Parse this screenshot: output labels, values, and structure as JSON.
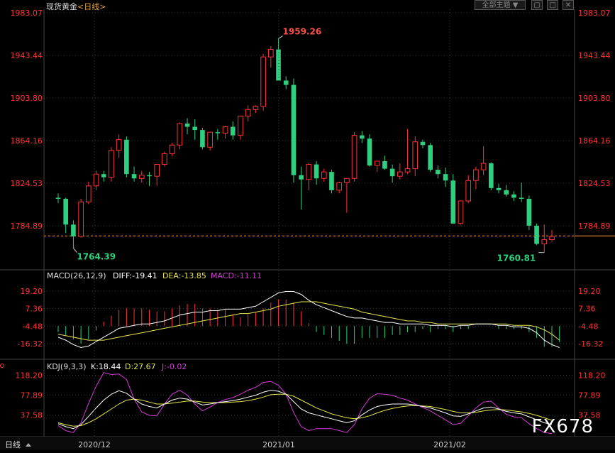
{
  "header": {
    "title": "现货黄金",
    "period": "<日线>",
    "theme_button": "全部主题",
    "theme_arrow": "▼"
  },
  "watermark": "FX678",
  "bottom_tab": "日线",
  "colors": {
    "up": "#ff3333",
    "down": "#2ecf7e",
    "axis": "#ff3333",
    "grid": "#3a3a3a",
    "white_line": "#ffffff",
    "yellow_line": "#e6e64c",
    "magenta_line": "#d43cd4",
    "current_price_line": "#ff9933"
  },
  "chart_data": [
    {
      "type": "candlestick",
      "title": "现货黄金<日线>",
      "y_ticks": [
        "1983.07",
        "1943.44",
        "1903.80",
        "1864.16",
        "1824.53",
        "1784.89"
      ],
      "ylim": [
        1745.25,
        1983.07
      ],
      "x_ticks": [
        "2020/12",
        "2021/01",
        "2021/02"
      ],
      "annotations": {
        "high": "1959.26",
        "low_left": "1764.39",
        "low_right": "1760.81"
      },
      "current_price": 1775.5,
      "candles": [
        [
          1811,
          1815,
          1806,
          1810
        ],
        [
          1810,
          1811,
          1778,
          1786
        ],
        [
          1786,
          1790,
          1764,
          1775
        ],
        [
          1775,
          1810,
          1774,
          1807
        ],
        [
          1807,
          1826,
          1805,
          1822
        ],
        [
          1822,
          1836,
          1818,
          1833
        ],
        [
          1833,
          1836,
          1826,
          1830
        ],
        [
          1830,
          1858,
          1826,
          1855
        ],
        [
          1855,
          1870,
          1848,
          1865
        ],
        [
          1865,
          1868,
          1830,
          1833
        ],
        [
          1833,
          1840,
          1826,
          1829
        ],
        [
          1829,
          1836,
          1825,
          1832
        ],
        [
          1832,
          1835,
          1822,
          1831
        ],
        [
          1831,
          1841,
          1822,
          1842
        ],
        [
          1842,
          1854,
          1840,
          1852
        ],
        [
          1852,
          1862,
          1850,
          1860
        ],
        [
          1860,
          1881,
          1856,
          1880
        ],
        [
          1880,
          1885,
          1870,
          1877
        ],
        [
          1877,
          1884,
          1865,
          1874
        ],
        [
          1874,
          1876,
          1856,
          1858
        ],
        [
          1858,
          1870,
          1855,
          1872
        ],
        [
          1872,
          1875,
          1865,
          1871
        ],
        [
          1871,
          1878,
          1866,
          1877
        ],
        [
          1877,
          1882,
          1865,
          1869
        ],
        [
          1869,
          1885,
          1865,
          1887
        ],
        [
          1887,
          1897,
          1882,
          1893
        ],
        [
          1893,
          1897,
          1890,
          1896
        ],
        [
          1896,
          1945,
          1892,
          1942
        ],
        [
          1942,
          1952,
          1932,
          1949
        ],
        [
          1949,
          1959,
          1945,
          1920
        ],
        [
          1920,
          1924,
          1912,
          1916
        ],
        [
          1916,
          1922,
          1825,
          1832
        ],
        [
          1832,
          1840,
          1800,
          1828
        ],
        [
          1828,
          1843,
          1818,
          1842
        ],
        [
          1842,
          1845,
          1823,
          1829
        ],
        [
          1829,
          1838,
          1826,
          1835
        ],
        [
          1835,
          1837,
          1815,
          1818
        ],
        [
          1818,
          1826,
          1815,
          1825
        ],
        [
          1825,
          1829,
          1797,
          1829
        ],
        [
          1829,
          1872,
          1826,
          1869
        ],
        [
          1869,
          1873,
          1862,
          1866
        ],
        [
          1866,
          1870,
          1840,
          1841
        ],
        [
          1841,
          1845,
          1835,
          1845
        ],
        [
          1845,
          1850,
          1837,
          1838
        ],
        [
          1838,
          1842,
          1825,
          1831
        ],
        [
          1831,
          1843,
          1828,
          1835
        ],
        [
          1835,
          1875,
          1833,
          1838
        ],
        [
          1838,
          1868,
          1831,
          1863
        ],
        [
          1863,
          1865,
          1857,
          1860
        ],
        [
          1860,
          1862,
          1835,
          1837
        ],
        [
          1837,
          1841,
          1829,
          1833
        ],
        [
          1833,
          1839,
          1821,
          1827
        ],
        [
          1827,
          1833,
          1789,
          1787
        ],
        [
          1787,
          1808,
          1786,
          1808
        ],
        [
          1808,
          1832,
          1806,
          1827
        ],
        [
          1827,
          1840,
          1819,
          1837
        ],
        [
          1837,
          1859,
          1832,
          1843
        ],
        [
          1843,
          1844,
          1818,
          1820
        ],
        [
          1820,
          1824,
          1815,
          1818
        ],
        [
          1818,
          1823,
          1812,
          1814
        ],
        [
          1814,
          1817,
          1808,
          1811
        ],
        [
          1811,
          1825,
          1807,
          1810
        ],
        [
          1810,
          1813,
          1781,
          1785
        ],
        [
          1785,
          1787,
          1767,
          1768
        ],
        [
          1768,
          1786,
          1760,
          1772
        ],
        [
          1772,
          1781,
          1770,
          1775
        ]
      ]
    },
    {
      "type": "macd",
      "label": "MACD(26,12,9)",
      "legend": {
        "diff": "DIFF:-19.41",
        "dea": "DEA:-13.85",
        "macd": "MACD:-11.11"
      },
      "y_ticks": [
        "19.20",
        "7.36",
        "-4.48",
        "-16.32"
      ],
      "ylim": [
        -26,
        25
      ],
      "diff": [
        -12,
        -14,
        -17,
        -19,
        -18,
        -15,
        -12,
        -9,
        -6,
        -5,
        -4,
        -3,
        -3,
        -2,
        -1,
        1,
        3,
        4,
        5,
        5,
        6,
        6,
        7,
        7,
        7,
        8,
        9,
        12,
        15,
        18,
        19,
        19,
        17,
        13,
        10,
        8,
        6,
        4,
        2,
        1,
        1,
        0,
        -1,
        -2,
        -2,
        -3,
        -3,
        -3,
        -3,
        -4,
        -4,
        -4,
        -5,
        -4,
        -4,
        -3,
        -3,
        -3,
        -4,
        -4,
        -5,
        -5,
        -6,
        -9,
        -14,
        -17,
        -19
      ],
      "dea": [
        -10,
        -11,
        -12,
        -13,
        -14,
        -14,
        -14,
        -13,
        -12,
        -11,
        -10,
        -9,
        -8,
        -7,
        -6,
        -5,
        -4,
        -3,
        -2,
        -1,
        0,
        1,
        2,
        3,
        4,
        4,
        5,
        6,
        7,
        9,
        10,
        11,
        12,
        12,
        12,
        11,
        10,
        9,
        8,
        7,
        5,
        4,
        3,
        2,
        1,
        0,
        -1,
        -1,
        -2,
        -2,
        -3,
        -3,
        -3,
        -3,
        -3,
        -3,
        -3,
        -3,
        -3,
        -3,
        -4,
        -4,
        -4,
        -5,
        -7,
        -10,
        -14
      ],
      "histogram": [
        -4,
        -6,
        -9,
        -12,
        -9,
        -3,
        3,
        7,
        11,
        12,
        12,
        12,
        11,
        10,
        10,
        12,
        14,
        15,
        15,
        12,
        12,
        11,
        11,
        8,
        6,
        8,
        9,
        12,
        16,
        18,
        18,
        16,
        10,
        2,
        -4,
        -6,
        -8,
        -10,
        -12,
        -12,
        -8,
        -8,
        -8,
        -8,
        -6,
        -6,
        -4,
        -4,
        -2,
        -4,
        -2,
        -2,
        -4,
        -2,
        -2,
        0,
        0,
        0,
        -2,
        -2,
        -2,
        -2,
        -4,
        -8,
        -14,
        -14,
        -11
      ]
    },
    {
      "type": "kdj",
      "label": "KDJ(9,3,3)",
      "legend": {
        "k": "K:18.44",
        "d": "D:27.67",
        "j": "J:-0.02"
      },
      "y_ticks": [
        "118.20",
        "77.89",
        "37.58"
      ],
      "ylim": [
        -2,
        125
      ],
      "k": [
        20,
        14,
        10,
        18,
        35,
        52,
        68,
        80,
        87,
        82,
        70,
        60,
        55,
        52,
        60,
        68,
        72,
        70,
        64,
        58,
        60,
        63,
        65,
        67,
        70,
        74,
        78,
        84,
        88,
        86,
        80,
        65,
        50,
        42,
        38,
        34,
        30,
        26,
        22,
        26,
        38,
        48,
        55,
        58,
        60,
        60,
        60,
        58,
        55,
        52,
        47,
        42,
        36,
        35,
        40,
        46,
        52,
        54,
        50,
        45,
        42,
        40,
        34,
        28,
        22,
        18
      ],
      "d": [
        22,
        18,
        15,
        16,
        22,
        30,
        40,
        50,
        60,
        68,
        70,
        68,
        64,
        60,
        60,
        62,
        64,
        66,
        66,
        64,
        63,
        63,
        63,
        64,
        65,
        67,
        70,
        74,
        79,
        80,
        80,
        76,
        68,
        60,
        52,
        46,
        40,
        36,
        32,
        30,
        32,
        36,
        42,
        47,
        51,
        54,
        56,
        57,
        56,
        55,
        52,
        49,
        45,
        42,
        42,
        43,
        46,
        48,
        49,
        48,
        46,
        44,
        41,
        37,
        32,
        27
      ],
      "j": [
        16,
        6,
        2,
        22,
        61,
        96,
        124,
        120,
        121,
        110,
        70,
        44,
        37,
        36,
        60,
        80,
        88,
        78,
        60,
        46,
        54,
        63,
        69,
        73,
        80,
        88,
        94,
        104,
        106,
        98,
        80,
        43,
        14,
        6,
        10,
        10,
        10,
        6,
        2,
        18,
        50,
        72,
        81,
        80,
        78,
        72,
        68,
        60,
        53,
        46,
        37,
        28,
        18,
        21,
        36,
        52,
        64,
        66,
        52,
        39,
        34,
        32,
        20,
        10,
        2,
        0
      ]
    }
  ]
}
